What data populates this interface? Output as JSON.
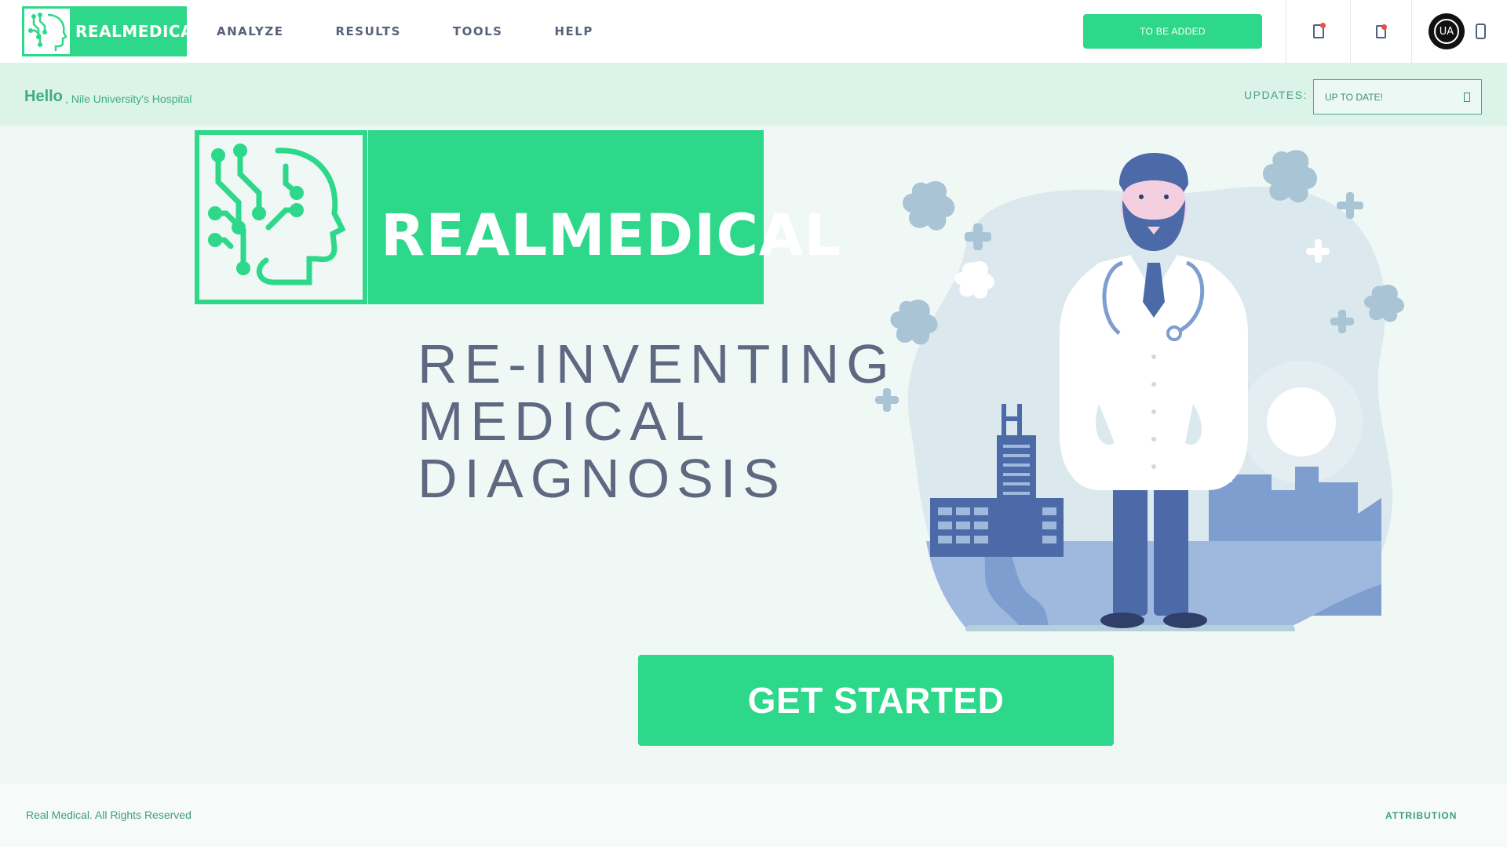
{
  "brand": {
    "name": "REALMEDICAL"
  },
  "nav": {
    "links": [
      "ANALYZE",
      "RESULTS",
      "TOOLS",
      "HELP"
    ],
    "action_button": "TO BE ADDED",
    "avatar_initials": "UA"
  },
  "greeting": {
    "hello": "Hello",
    "org": ", Nile University's Hospital",
    "updates_label": "UPDATES:",
    "updates_value": "UP TO DATE!"
  },
  "hero": {
    "tagline": [
      "RE-INVENTING",
      "MEDICAL",
      "DIAGNOSIS"
    ],
    "cta": "GET STARTED"
  },
  "footer": {
    "copyright": "Real Medical. All Rights Reserved",
    "attribution": "ATTRIBUTION"
  },
  "colors": {
    "accent": "#2ed88a",
    "greeting_bar": "#dcf3ea",
    "text": "#5e6880",
    "notification": "#f04a4a"
  }
}
